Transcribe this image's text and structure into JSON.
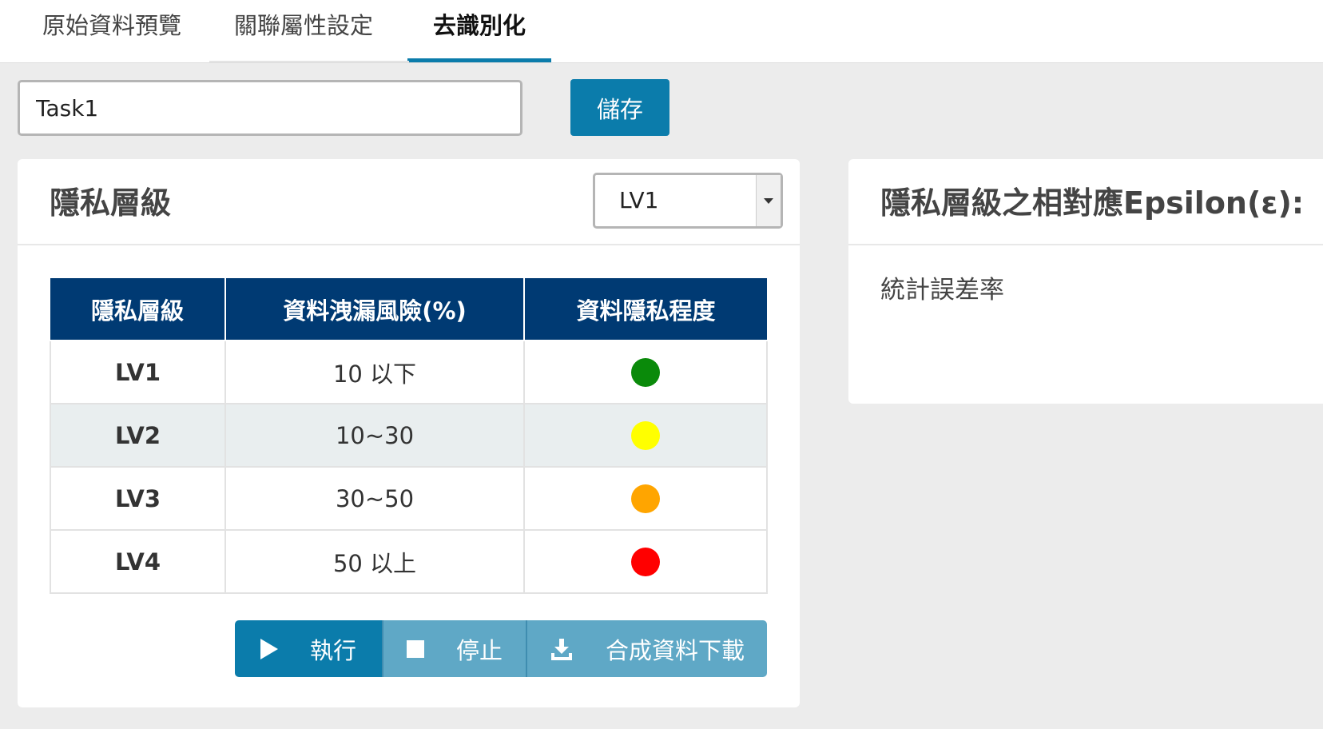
{
  "tabs": [
    {
      "label": "原始資料預覽",
      "active": false
    },
    {
      "label": "關聯屬性設定",
      "active": false
    },
    {
      "label": "去識別化",
      "active": true
    }
  ],
  "task": {
    "value": "Task1",
    "save_label": "儲存"
  },
  "privacy_panel": {
    "title": "隱私層級",
    "selected_level": "LV1",
    "table": {
      "headers": [
        "隱私層級",
        "資料洩漏風險(%)",
        "資料隱私程度"
      ],
      "rows": [
        {
          "level": "LV1",
          "risk": "10 以下",
          "color": "#0a8a0a"
        },
        {
          "level": "LV2",
          "risk": "10~30",
          "color": "#ffff00"
        },
        {
          "level": "LV3",
          "risk": "30~50",
          "color": "#ffa500"
        },
        {
          "level": "LV4",
          "risk": "50 以上",
          "color": "#ff0000"
        }
      ]
    },
    "actions": {
      "run_label": "執行",
      "stop_label": "停止",
      "download_label": "合成資料下載",
      "run_icon": "play-icon",
      "stop_icon": "stop-icon",
      "download_icon": "download-icon"
    }
  },
  "epsilon_panel": {
    "title": "隱私層級之相對應Epsilon(ε):",
    "label": "統計誤差率"
  },
  "colors": {
    "accent": "#0b7cab",
    "table_header": "#003a73",
    "button_secondary": "#5fa8c6"
  }
}
